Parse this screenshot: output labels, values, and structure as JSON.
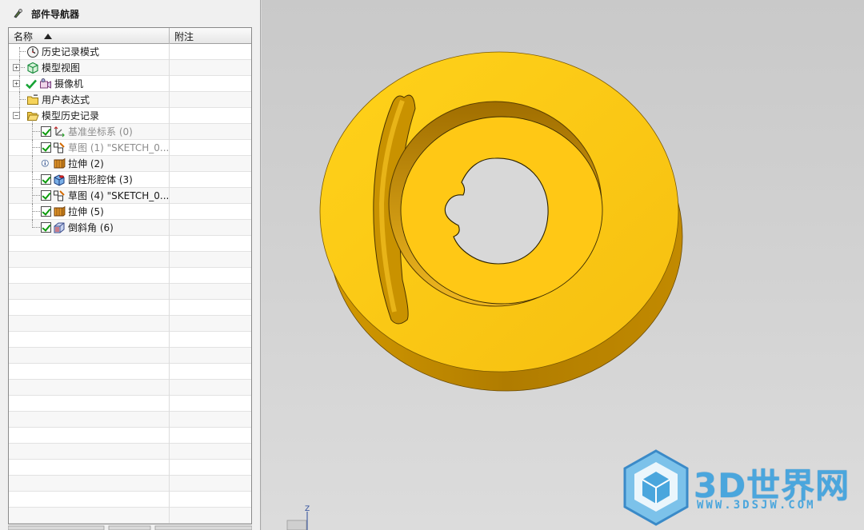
{
  "navigator": {
    "title": "部件导航器",
    "columns": {
      "name": "名称",
      "note": "附注"
    },
    "items": [
      {
        "label": "历史记录模式",
        "dim": false
      },
      {
        "label": "模型视图",
        "dim": false
      },
      {
        "label": "摄像机",
        "dim": false
      },
      {
        "label": "用户表达式",
        "dim": false
      },
      {
        "label": "模型历史记录",
        "dim": false
      },
      {
        "label": "基准坐标系 (0)",
        "dim": true
      },
      {
        "label": "草图 (1) \"SKETCH_0...",
        "dim": true
      },
      {
        "label": "拉伸 (2)",
        "dim": false
      },
      {
        "label": "圆柱形腔体 (3)",
        "dim": false
      },
      {
        "label": "草图 (4) \"SKETCH_0...",
        "dim": false
      },
      {
        "label": "拉伸 (5)",
        "dim": false
      },
      {
        "label": "倒斜角 (6)",
        "dim": false
      }
    ]
  },
  "viewport": {
    "model_color": "#f5c518",
    "model_shade_color": "#c99a00",
    "triad_axis": "Z"
  },
  "watermark": {
    "brand": "3D世界网",
    "url": "WWW.3DSJW.COM",
    "color": "#4aa6dd"
  },
  "icons": {
    "title": "part-navigator-icon",
    "history_mode": "clock-icon",
    "model_views": "model-view-icon",
    "cameras": "camera-icon",
    "expressions": "folder-icon",
    "history": "folder-open-icon",
    "datum": "datum-csys-icon",
    "sketch": "sketch-icon",
    "extrude": "extrude-icon",
    "pocket": "pocket-icon",
    "chamfer": "chamfer-icon"
  }
}
